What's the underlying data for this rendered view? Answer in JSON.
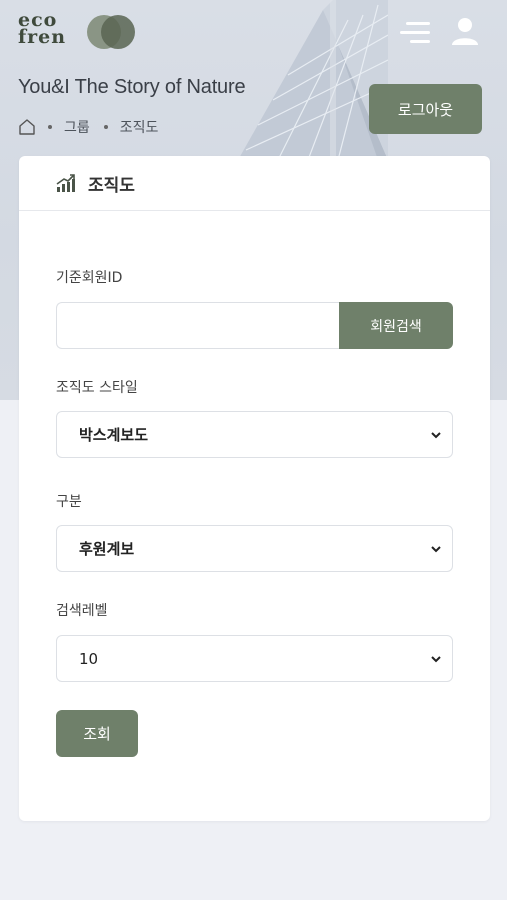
{
  "header": {
    "logo_line1": "eco",
    "logo_line2": "fren",
    "site_title": "You&I The Story of Nature",
    "logout_label": "로그아웃",
    "menu_icon": "menu-lines-icon",
    "user_icon": "user-icon"
  },
  "breadcrumb": {
    "home_icon": "home-icon",
    "items": [
      "그룹",
      "조직도"
    ]
  },
  "card": {
    "title": "조직도",
    "title_icon": "chart-growth-icon",
    "member_id_label": "기준회원ID",
    "member_id_value": "",
    "member_search_label": "회원검색",
    "style_label": "조직도 스타일",
    "style_value": "박스계보도",
    "type_label": "구분",
    "type_value": "후원계보",
    "level_label": "검색레벨",
    "level_value": "10",
    "query_label": "조회"
  },
  "colors": {
    "accent": "#6f806a",
    "background": "#eef0f5",
    "card": "#ffffff"
  }
}
